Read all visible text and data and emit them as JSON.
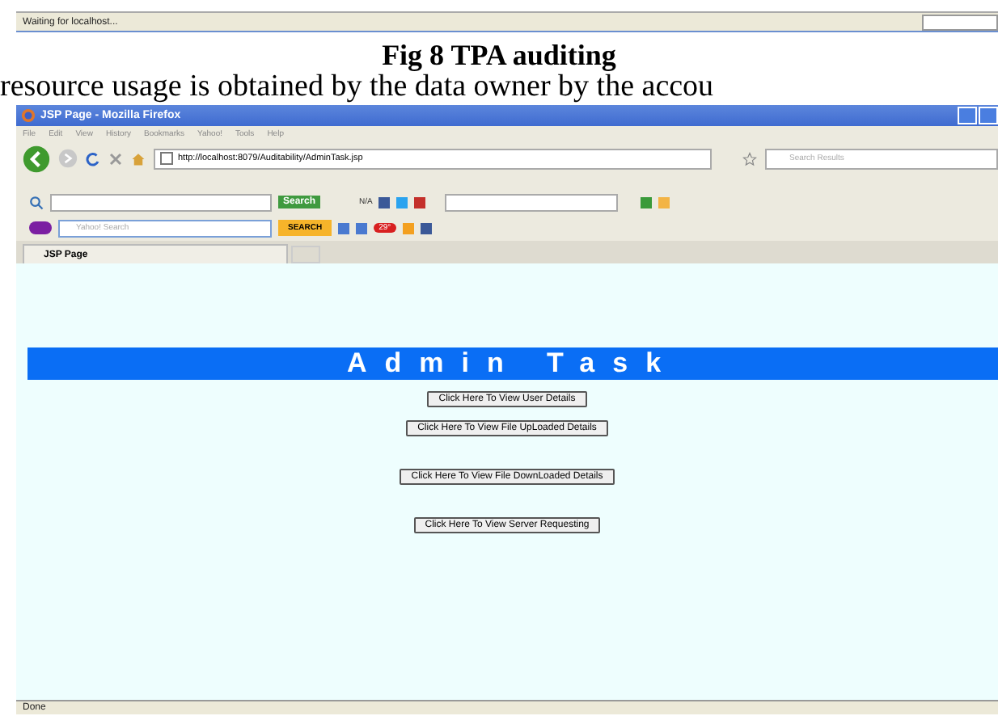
{
  "top_status": {
    "text": "Waiting for localhost..."
  },
  "caption": "Fig 8 TPA auditing",
  "body_text": "resource usage is obtained by the data owner by the accou",
  "window": {
    "title": "JSP Page - Mozilla Firefox"
  },
  "menu": [
    "File",
    "Edit",
    "View",
    "History",
    "Bookmarks",
    "Yahoo!",
    "Tools",
    "Help"
  ],
  "address": "http://localhost:8079/Auditability/AdminTask.jsp",
  "search_placeholder": "Search Results",
  "toolbar_search_button": "Search",
  "toolbar_na": "N/A",
  "yahoo_placeholder": "Yahoo! Search",
  "yahoo_search_button": "SEARCH",
  "weather_badge": "29°",
  "tabs": [
    {
      "label": "JSP Page",
      "selected": true
    }
  ],
  "page": {
    "heading": "Admin Task",
    "buttons": [
      "Click Here To View User Details",
      "Click Here To View File UpLoaded Details",
      "Click Here To View File DownLoaded  Details",
      "Click Here To View Server Requesting"
    ]
  },
  "status_bar": "Done"
}
